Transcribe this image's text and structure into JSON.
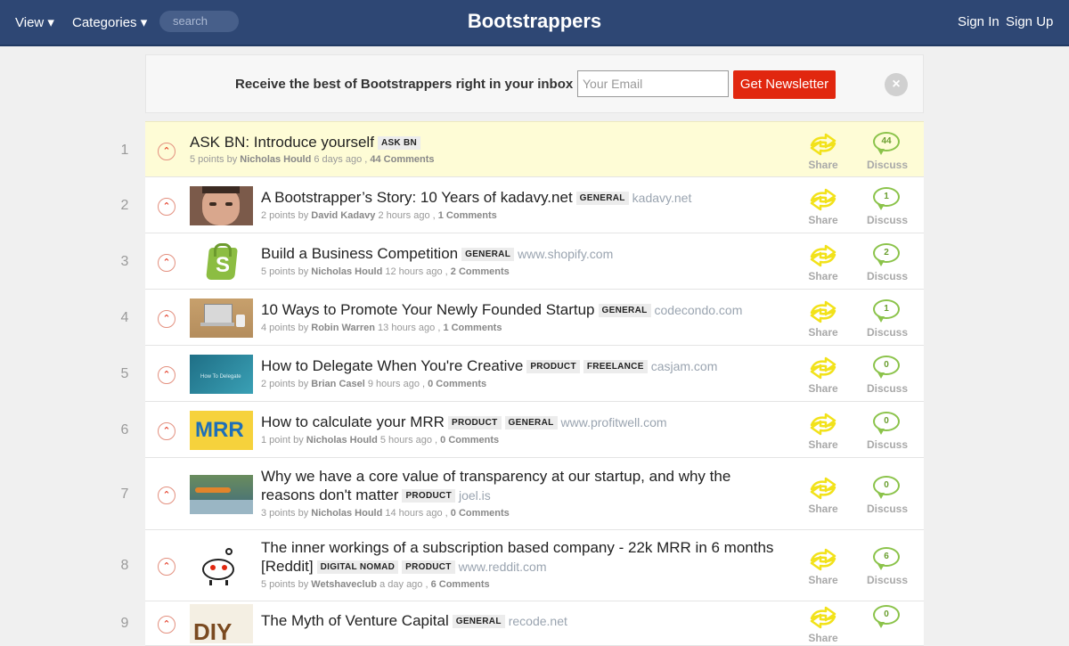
{
  "nav": {
    "view_label": "View ▾",
    "categories_label": "Categories ▾",
    "search_placeholder": "search",
    "brand": "Bootstrappers",
    "sign_in": "Sign In",
    "sign_up": "Sign Up"
  },
  "newsletter": {
    "text": "Receive the best of Bootstrappers right in your inbox",
    "email_placeholder": "Your Email",
    "button_label": "Get Newsletter",
    "close_label": "×"
  },
  "actions": {
    "share_label": "Share",
    "discuss_label": "Discuss",
    "upvote_glyph": "⌃"
  },
  "posts": [
    {
      "rank": "1",
      "title": "ASK BN: Introduce yourself",
      "tags": [
        "ASK BN"
      ],
      "domain": "",
      "points": "5 points by",
      "author": "Nicholas Hould",
      "time": "6 days ago ,",
      "comments": "44 Comments",
      "discuss_count": "44",
      "thumb": "none"
    },
    {
      "rank": "2",
      "title": "A Bootstrapper’s Story: 10 Years of kadavy.net",
      "tags": [
        "GENERAL"
      ],
      "domain": "kadavy.net",
      "points": "2 points by",
      "author": "David Kadavy",
      "time": "2 hours ago ,",
      "comments": "1 Comments",
      "discuss_count": "1",
      "thumb": "face"
    },
    {
      "rank": "3",
      "title": "Build a Business Competition",
      "tags": [
        "GENERAL"
      ],
      "domain": "www.shopify.com",
      "points": "5 points by",
      "author": "Nicholas Hould",
      "time": "12 hours ago ,",
      "comments": "2 Comments",
      "discuss_count": "2",
      "thumb": "shopify"
    },
    {
      "rank": "4",
      "title": "10 Ways to Promote Your Newly Founded Startup",
      "tags": [
        "GENERAL"
      ],
      "domain": "codecondo.com",
      "points": "4 points by",
      "author": "Robin Warren",
      "time": "13 hours ago ,",
      "comments": "1 Comments",
      "discuss_count": "1",
      "thumb": "desk"
    },
    {
      "rank": "5",
      "title": "How to Delegate When You're Creative",
      "tags": [
        "PRODUCT",
        "FREELANCE"
      ],
      "domain": "casjam.com",
      "points": "2 points by",
      "author": "Brian Casel",
      "time": "9 hours ago ,",
      "comments": "0 Comments",
      "discuss_count": "0",
      "thumb": "delegate",
      "thumb_text": "How To Delegate"
    },
    {
      "rank": "6",
      "title": "How to calculate your MRR",
      "tags": [
        "PRODUCT",
        "GENERAL"
      ],
      "domain": "www.profitwell.com",
      "points": "1 point by",
      "author": "Nicholas Hould",
      "time": "5 hours ago ,",
      "comments": "0 Comments",
      "discuss_count": "0",
      "thumb": "mrr",
      "thumb_text": "MRR"
    },
    {
      "rank": "7",
      "title": "Why we have a core value of transparency at our startup, and why the reasons don't matter",
      "tags": [
        "PRODUCT"
      ],
      "domain": "joel.is",
      "points": "3 points by",
      "author": "Nicholas Hould",
      "time": "14 hours ago ,",
      "comments": "0 Comments",
      "discuss_count": "0",
      "thumb": "water"
    },
    {
      "rank": "8",
      "title": "The inner workings of a subscription based company - 22k MRR in 6 months [Reddit]",
      "tags": [
        "DIGITAL NOMAD",
        "PRODUCT"
      ],
      "domain": "www.reddit.com",
      "points": "5 points by",
      "author": "Wetshaveclub",
      "time": "a day ago ,",
      "comments": "6 Comments",
      "discuss_count": "6",
      "thumb": "reddit"
    },
    {
      "rank": "9",
      "title": "The Myth of Venture Capital",
      "tags": [
        "GENERAL"
      ],
      "domain": "recode.net",
      "points": "",
      "author": "",
      "time": "",
      "comments": "",
      "discuss_count": "0",
      "thumb": "diy",
      "thumb_text": "DIY"
    }
  ],
  "colors": {
    "navbar": "#2e4774",
    "accent_red": "#e1270f",
    "share_yellow": "#f2e21a",
    "discuss_green": "#8bc34a",
    "highlight": "#fefcd6"
  }
}
